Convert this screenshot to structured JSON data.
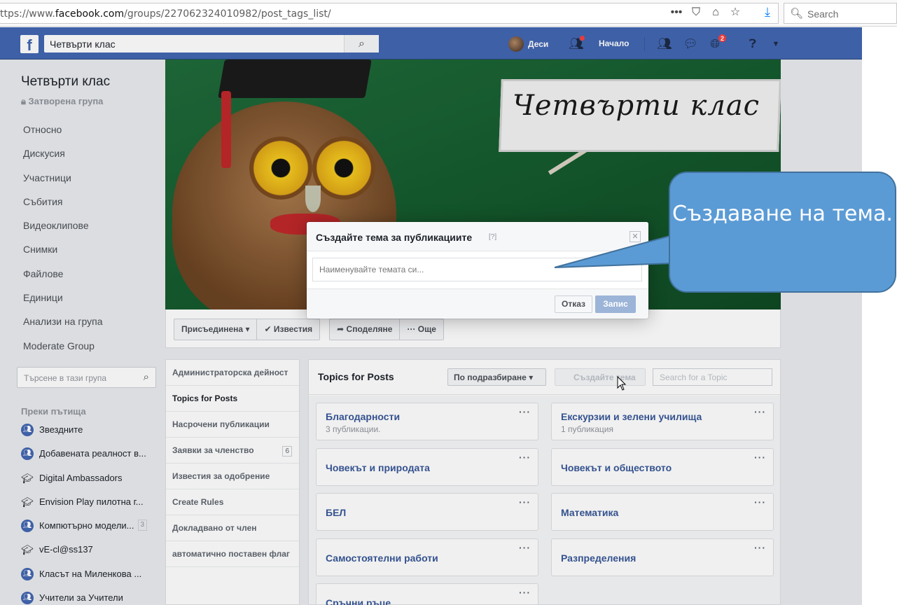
{
  "browser": {
    "url_prefix": "ttps://www.",
    "url_domain": "facebook.com",
    "url_path": "/groups/227062324010982/post_tags_list/",
    "search_placeholder": "Search"
  },
  "topbar": {
    "logo": "f",
    "search_value": "Четвърти клас",
    "user_name": "Деси",
    "home_label": "Начало",
    "notifications_count": "2"
  },
  "group": {
    "name": "Четвърти клас",
    "status": "Затворена група",
    "nav": [
      "Относно",
      "Дискусия",
      "Участници",
      "Събития",
      "Видеоклипове",
      "Снимки",
      "Файлове",
      "Единици",
      "Анализи на група",
      "Moderate Group"
    ],
    "search_placeholder": "Търсене в тази група"
  },
  "shortcuts": {
    "title": "Преки пътища",
    "items": [
      {
        "label": "Звездните",
        "icon": "group-icon"
      },
      {
        "label": "Добавената реалност в...",
        "icon": "group-icon"
      },
      {
        "label": "Digital Ambassadors",
        "icon": "graduation-cap-icon"
      },
      {
        "label": "Envision Play пилотна г...",
        "icon": "graduation-cap-icon"
      },
      {
        "label": "Компютърно модели...",
        "icon": "group-icon",
        "count": "3"
      },
      {
        "label": "vE-cl@ss137",
        "icon": "graduation-cap-icon"
      },
      {
        "label": "Класът на Миленкова ...",
        "icon": "group-icon"
      },
      {
        "label": "Учители за Учители",
        "icon": "group-icon"
      }
    ]
  },
  "cover": {
    "sign_text": "Четвърти клас"
  },
  "actions": {
    "joined": "Присъединена",
    "notifications": "Известия",
    "share": "Споделяне",
    "more": "Още"
  },
  "adminnav": {
    "items": [
      {
        "label": "Администраторска дейност"
      },
      {
        "label": "Topics for Posts",
        "active": true
      },
      {
        "label": "Насрочени публикации"
      },
      {
        "label": "Заявки за членство",
        "count": "6"
      },
      {
        "label": "Известия за одобрение"
      },
      {
        "label": "Create Rules"
      },
      {
        "label": "Докладвано от член"
      },
      {
        "label": "автоматично поставен флаг"
      }
    ]
  },
  "topics": {
    "title": "Topics for Posts",
    "sort_label": "По подразбиране",
    "create_label": "Създайте тема",
    "search_placeholder": "Search for a Topic",
    "cards": [
      {
        "name": "Благодарности",
        "count": "3 публикации."
      },
      {
        "name": "Екскурзии и зелени училища",
        "count": "1 публикация"
      },
      {
        "name": "Човекът и природата"
      },
      {
        "name": "Човекът и обществото"
      },
      {
        "name": "БЕЛ"
      },
      {
        "name": "Математика"
      },
      {
        "name": "Самостоятелни работи"
      },
      {
        "name": "Разпределения"
      },
      {
        "name": "Сръчни ръце"
      }
    ]
  },
  "dialog": {
    "title": "Създайте тема за публикациите",
    "help": "[?]",
    "input_placeholder": "Наименувайте темата си...",
    "cancel": "Отказ",
    "save": "Запис"
  },
  "callout": {
    "text": "Създаване на тема."
  },
  "colors": {
    "fb_blue": "#4267b2",
    "link_blue": "#385898",
    "callout_fill": "#5b9bd5",
    "callout_border": "#41719c"
  }
}
